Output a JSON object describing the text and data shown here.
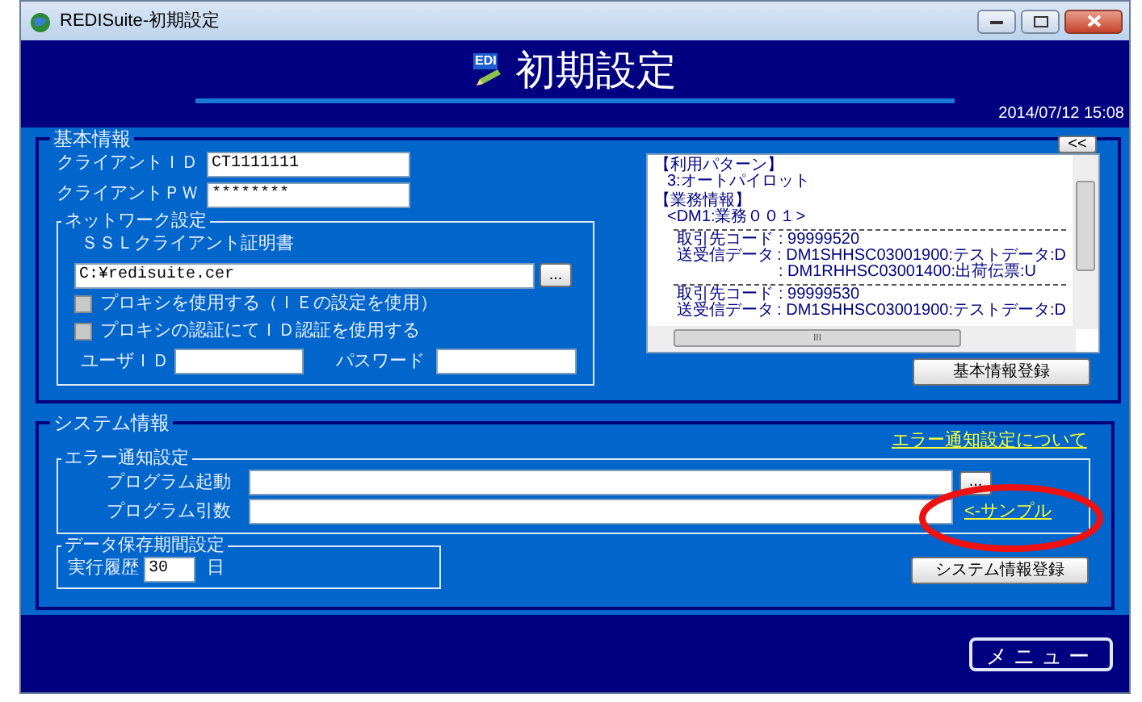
{
  "window": {
    "title": "REDISuite-初期設定"
  },
  "header": {
    "logo_text": "EDI",
    "title": "初期設定",
    "datetime": "2014/07/12 15:08"
  },
  "basic_info": {
    "legend": "基本情報",
    "fields": [
      {
        "label": "クライアントＩＤ",
        "value": "CT1111111"
      },
      {
        "label": "クライアントＰＷ",
        "value": "********"
      }
    ],
    "network": {
      "legend": "ネットワーク設定",
      "cert_label": "ＳＳＬクライアント証明書",
      "cert_path": "C:¥redisuite.cer",
      "browse": "...",
      "options": [
        {
          "label": "プロキシを使用する（ＩＥの設定を使用）",
          "checked": false
        },
        {
          "label": "プロキシの認証にてＩＤ認証を使用する",
          "checked": false
        }
      ],
      "user_label": "ユーザＩＤ",
      "password_label": "パスワード"
    },
    "collapse_button": "<<",
    "summary_lines": [
      {
        "kind": "heading",
        "text": "【利用パターン】"
      },
      {
        "kind": "text",
        "text": "3:オートパイロット"
      },
      {
        "kind": "blank"
      },
      {
        "kind": "heading",
        "text": "【業務情報】"
      },
      {
        "kind": "text",
        "text": "<DM1:業務００１>"
      },
      {
        "kind": "separator"
      },
      {
        "kind": "pair",
        "label": "取引先コード",
        "value": ": 99999520"
      },
      {
        "kind": "pair",
        "label": "送受信データ",
        "value": ": DM1SHHSC03001900:テストデータ:D"
      },
      {
        "kind": "cont",
        "value": ": DM1RHHSC03001400:出荷伝票:U"
      },
      {
        "kind": "separator"
      },
      {
        "kind": "pair",
        "label": "取引先コード",
        "value": ": 99999530"
      },
      {
        "kind": "pair",
        "label": "送受信データ",
        "value": ": DM1SHHSC03001900:テストデータ:D"
      }
    ],
    "scroll_label": "III",
    "register_button": "基本情報登録"
  },
  "system_info": {
    "legend": "システム情報",
    "help_link": "エラー通知設定について",
    "error_notice": {
      "legend": "エラー通知設定",
      "program_label": "プログラム起動",
      "browse": "...",
      "args_label": "プログラム引数",
      "sample_link": "<-サンプル"
    },
    "retention": {
      "legend": "データ保存期間設定",
      "history_label": "実行履歴",
      "history_value": "30",
      "unit": "日"
    },
    "register_button": "システム情報登録"
  },
  "footer": {
    "menu_button": "メニュー"
  }
}
